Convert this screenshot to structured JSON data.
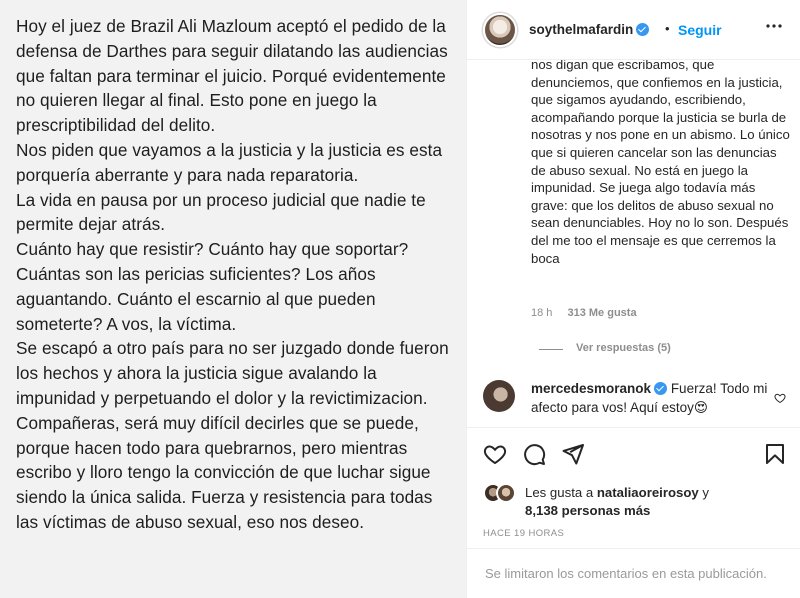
{
  "post_image": {
    "paragraphs": [
      "Hoy el juez de Brazil Ali Mazloum aceptó el pedido de la defensa de Darthes para seguir dilatando las audiencias que faltan para terminar el juicio. Porqué evidentemente no quieren llegar al final. Esto pone en juego la prescriptibilidad del delito.",
      "Nos piden que vayamos a la justicia y la justicia es esta porquería aberrante y para nada reparatoria.",
      "La vida en pausa por un proceso judicial que nadie te permite dejar atrás.",
      "Cuánto hay que resistir? Cuánto hay que soportar? Cuántas son las pericias suficientes? Los años aguantando. Cuánto el escarnio al que pueden someterte? A vos, la víctima.",
      "Se escapó a otro país para no ser juzgado donde fueron los hechos y ahora la justicia sigue avalando la impunidad y perpetuando el dolor y la revictimizacion. Compañeras, será muy difícil decirles que se puede, porque hacen todo para quebrarnos, pero mientras escribo y lloro tengo la convicción de que luchar sigue siendo la única salida. Fuerza y resistencia para todas las víctimas de abuso sexual, eso nos deseo."
    ]
  },
  "header": {
    "username": "soythelmafardin",
    "separator": "•",
    "follow_label": "Seguir",
    "more_icon": "more-options-icon"
  },
  "caption_tail": "nos digan que escribamos, que denunciemos, que confiemos en la justicia, que sigamos ayudando, escribiendo, acompañando porque la justicia se burla de nosotras y nos pone en un abismo. Lo único que si quieren cancelar son las denuncias de abuso sexual. No está en juego la impunidad. Se juega algo todavía más grave: que los delitos de abuso sexual no sean denunciables. Hoy no lo son. Después del me too el mensaje es que cerremos la boca",
  "caption_meta": {
    "time": "18 h",
    "likes": "313 Me gusta"
  },
  "view_replies": "Ver respuestas (5)",
  "comment": {
    "username": "mercedesmoranok",
    "text": " Fuerza! Todo mi afecto para vos! Aquí estoy😍"
  },
  "liked_by": {
    "prefix": "Les gusta a ",
    "user": "nataliaoreirosoy",
    "middle": " y ",
    "count": "8,138 personas más"
  },
  "time_ago": "HACE 19 HORAS",
  "comments_limited": "Se limitaron los comentarios en esta publicación.",
  "colors": {
    "accent": "#0095f6",
    "verified": "#3897f0",
    "muted": "#8e8e8e"
  }
}
